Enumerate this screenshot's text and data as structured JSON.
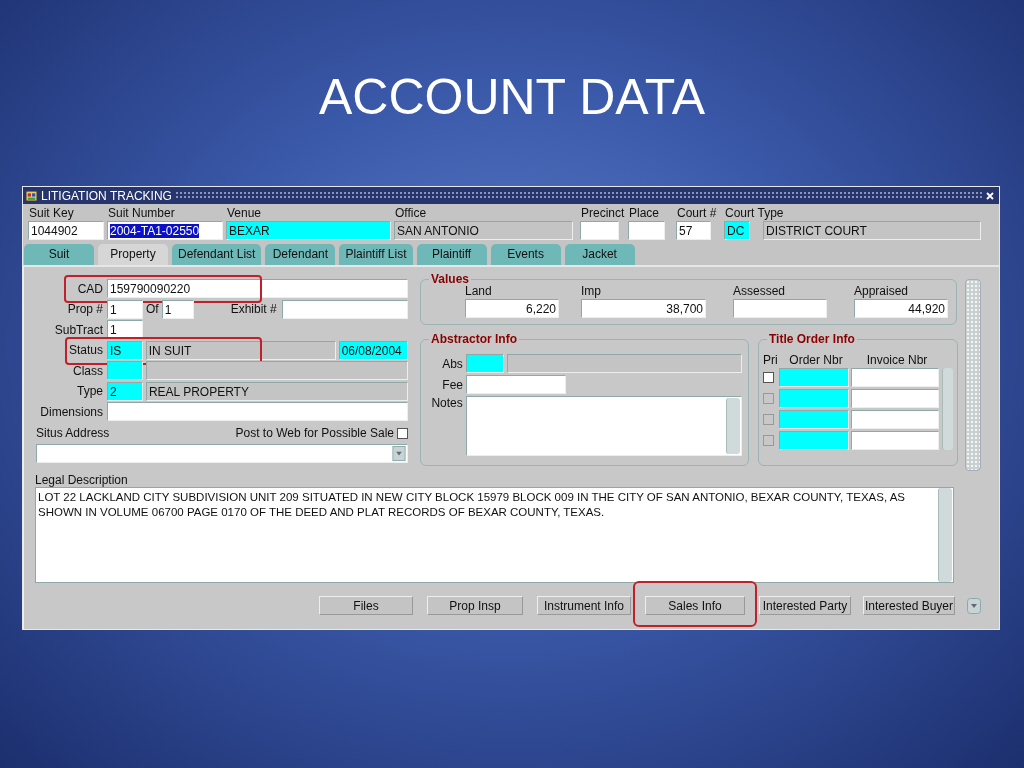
{
  "slide_title": "ACCOUNT DATA",
  "window": {
    "title": "LITIGATION TRACKING"
  },
  "header_fields": [
    {
      "label": "Suit Key",
      "value": "1044902",
      "kind": "plain"
    },
    {
      "label": "Suit Number",
      "value": "2004-TA1-02550",
      "kind": "selected-text"
    },
    {
      "label": "Venue",
      "value": "BEXAR",
      "kind": "lookup"
    },
    {
      "label": "Office",
      "value": "SAN ANTONIO",
      "kind": "readonly"
    },
    {
      "label": "Precinct",
      "kind": "plain"
    },
    {
      "label": "Place",
      "kind": "plain"
    },
    {
      "label": "Court #",
      "value": "57",
      "kind": "plain"
    },
    {
      "label": "Court Type",
      "value": "DC",
      "kind": "lookup"
    },
    {
      "value": "DISTRICT COURT",
      "kind": "readonly"
    }
  ],
  "tabs": [
    {
      "label": "Suit",
      "selected": false
    },
    {
      "label": "Property",
      "selected": true
    },
    {
      "label": "Defendant List",
      "selected": false
    },
    {
      "label": "Defendant",
      "selected": false
    },
    {
      "label": "Plaintiff List",
      "selected": false
    },
    {
      "label": "Plaintiff",
      "selected": false
    },
    {
      "label": "Events",
      "selected": false
    },
    {
      "label": "Jacket",
      "selected": false
    }
  ],
  "property": {
    "cad": {
      "label": "CAD",
      "value": "159790090220",
      "highlighted": true
    },
    "prop_num": {
      "label": "Prop #",
      "value": "1"
    },
    "of": {
      "label": "Of",
      "value": "1"
    },
    "exhibit": {
      "label": "Exhibit #"
    },
    "subtract": {
      "label": "SubTract",
      "value": "1"
    },
    "status": {
      "label": "Status",
      "code": "IS",
      "description": "IN SUIT",
      "date": "06/08/2004",
      "highlighted": true
    },
    "class": {
      "label": "Class"
    },
    "type": {
      "label": "Type",
      "code": "2",
      "description": "REAL PROPERTY"
    },
    "dimensions": {
      "label": "Dimensions"
    },
    "situs_address": {
      "label": "Situs Address"
    },
    "post_to_web": {
      "label": "Post to Web for Possible Sale",
      "checked": false
    }
  },
  "values": {
    "title": "Values",
    "fields": [
      {
        "label": "Land",
        "value": "6,220"
      },
      {
        "label": "Imp",
        "value": "38,700"
      },
      {
        "label": "Assessed"
      },
      {
        "label": "Appraised",
        "value": "44,920"
      }
    ]
  },
  "abstractor_info": {
    "title": "Abstractor Info",
    "abs_label": "Abs",
    "fee_label": "Fee",
    "notes_label": "Notes"
  },
  "title_order_info": {
    "title": "Title Order Info",
    "columns": [
      "Pri",
      "Order Nbr",
      "Invoice Nbr"
    ],
    "rows": [
      {
        "checked": false,
        "disabled": false
      },
      {
        "checked": false,
        "disabled": true
      },
      {
        "checked": false,
        "disabled": true
      },
      {
        "checked": false,
        "disabled": true
      }
    ]
  },
  "legal_description": {
    "label": "Legal Description",
    "text": "LOT 22 LACKLAND CITY SUBDIVISION UNIT 209 SITUATED IN NEW CITY BLOCK 15979 BLOCK 009 IN THE CITY OF SAN ANTONIO, BEXAR COUNTY, TEXAS, AS SHOWN IN VOLUME 06700 PAGE 0170 OF THE DEED AND PLAT RECORDS OF BEXAR COUNTY, TEXAS."
  },
  "buttons": [
    {
      "label": "Files",
      "highlighted": false
    },
    {
      "label": "Prop Insp",
      "highlighted": false
    },
    {
      "label": "Instrument Info",
      "highlighted": false
    },
    {
      "label": "Sales Info",
      "highlighted": true
    },
    {
      "label": "Interested Party",
      "highlighted": false
    },
    {
      "label": "Interested Buyer",
      "highlighted": false
    }
  ]
}
